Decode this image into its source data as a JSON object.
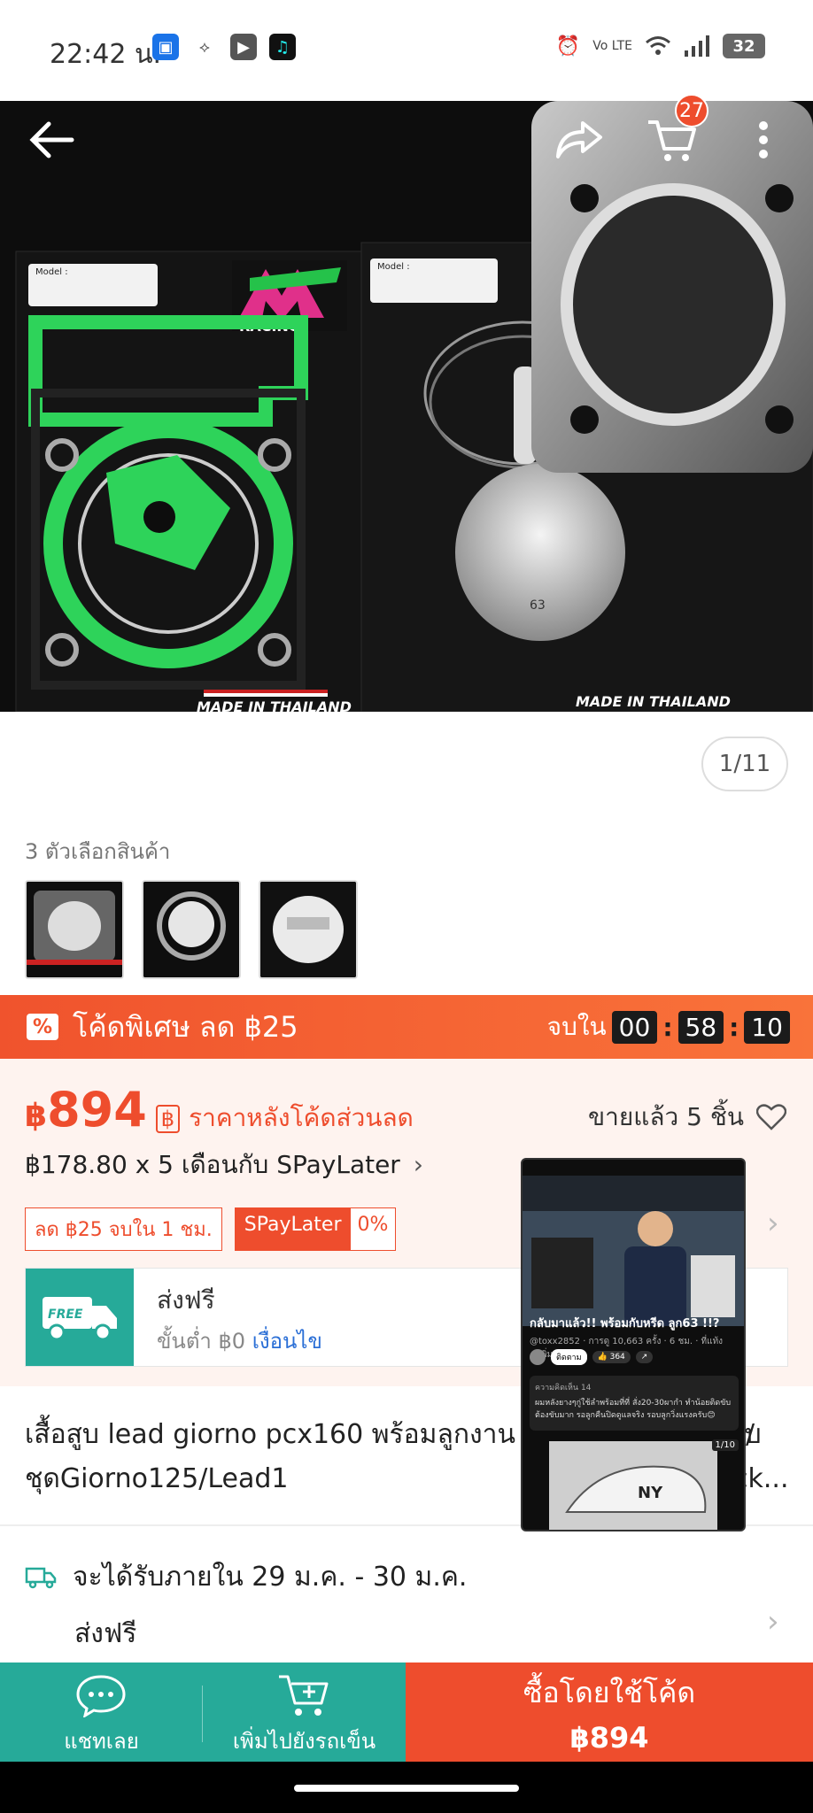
{
  "status_bar": {
    "time": "22:42 น.",
    "battery": "32"
  },
  "product_images": {
    "pager": "1/11",
    "brand_text": "RACING",
    "made_in_left": "MADE IN THAILAND",
    "made_in_right": "MADE IN THAILAND",
    "model_label": "Model :",
    "piston_mark": "63"
  },
  "cart": {
    "count": "27"
  },
  "variants": {
    "label": "3 ตัวเลือกสินค้า"
  },
  "promo": {
    "text": "โค้ดพิเศษ ลด ฿25",
    "ends_label": "จบใน",
    "hours": "00",
    "minutes": "58",
    "seconds": "10"
  },
  "price": {
    "currency": "฿",
    "amount": "894",
    "note": "ราคาหลังโค้ดส่วนลด",
    "sold": "ขายแล้ว 5 ชิ้น",
    "installment": "฿178.80 x 5 เดือนกับ SPayLater",
    "chip_discount": "ลด ฿25 จบใน 1 ชม.",
    "chip_spay": "SPayLater",
    "chip_spay_rate": "0%"
  },
  "shipping": {
    "badge": "FREE",
    "title": "ส่งฟรี",
    "sub": "ขั้นต่ำ ฿0",
    "condition": "เงื่อนไข"
  },
  "product_title": "เสื้อสูบ lead giorno pcx160 พร้อมลูกงาน 62mm/63mm.ครบชุดGiorno125/Lead1",
  "product_title_trail": "/",
  "product_title_end": "ck...",
  "delivery": {
    "text": "จะได้รับภายใน 29 ม.ค. - 30 ม.ค.",
    "free": "ส่งฟรี"
  },
  "floating_video": {
    "title": "กลับมาแล้ว!! พร้อมกับหรีด ลูก63 !!?",
    "meta": "@toxx2852 · การดู 10,663 ครั้ง · 6 ชม. · ที่แท้ง ...เพิ่มเติม",
    "subscribe": "ติดตาม",
    "likes": "364",
    "comments_label": "ความคิดเห็น 14",
    "comment": "ผมหลังยางๆกู่ใช้ลำพร้อมที่ที่ สั่ง20-30ผากำ ทำน้อยติดขับ ต้องขับมาก รอลูกคืนปิดดูแลจริง รอบลูกวิ่งแรงครับ😊",
    "counter": "1/10"
  },
  "bottom_bar": {
    "chat": "แชทเลย",
    "add_cart": "เพิ่มไปยังรถเข็น",
    "buy_line1": "ซื้อโดยใช้โค้ด",
    "buy_price": "฿894"
  },
  "colors": {
    "shopee_orange": "#ee4d2d",
    "teal": "#26aa99",
    "gasket_green": "#2ed35a"
  }
}
